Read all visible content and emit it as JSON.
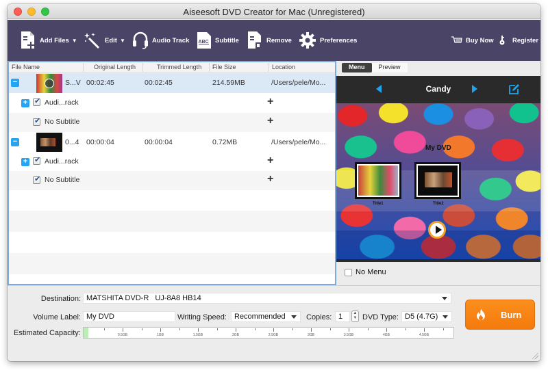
{
  "window": {
    "title": "Aiseesoft DVD Creator for Mac (Unregistered)"
  },
  "toolbar": {
    "add_files": "Add Files",
    "edit": "Edit",
    "audio_track": "Audio Track",
    "subtitle": "Subtitle",
    "remove": "Remove",
    "preferences": "Preferences",
    "buy_now": "Buy Now",
    "register": "Register"
  },
  "file_list": {
    "columns": [
      "File Name",
      "Original Length",
      "Trimmed Length",
      "File Size",
      "Location"
    ],
    "files": [
      {
        "name": "S...V",
        "original_length": "00:02:45",
        "trimmed_length": "00:02:45",
        "file_size": "214.59MB",
        "location": "/Users/pele/Mo...",
        "audio_track": "Audi...rack",
        "subtitle": "No Subtitle",
        "selected": true
      },
      {
        "name": "0...4",
        "original_length": "00:00:04",
        "trimmed_length": "00:00:04",
        "file_size": "0.72MB",
        "location": "/Users/pele/Mo...",
        "audio_track": "Audi...rack",
        "subtitle": "No Subtitle",
        "selected": false
      }
    ]
  },
  "preview": {
    "tabs": [
      {
        "label": "Menu",
        "active": true
      },
      {
        "label": "Preview",
        "active": false
      }
    ],
    "theme_name": "Candy",
    "dvd_title": "My DVD",
    "titles": [
      "Title1",
      "Title2"
    ],
    "no_menu_label": "No Menu",
    "no_menu_checked": false
  },
  "settings": {
    "destination_label": "Destination:",
    "destination_value": "MATSHITA DVD-R   UJ-8A8 HB14",
    "volume_label_label": "Volume Label:",
    "volume_label_value": "My DVD",
    "writing_speed_label": "Writing Speed:",
    "writing_speed_value": "Recommended",
    "copies_label": "Copies:",
    "copies_value": "1",
    "dvd_type_label": "DVD Type:",
    "dvd_type_value": "D5 (4.7G)",
    "capacity_label": "Estimated Capacity:",
    "capacity_used_fraction": 0.025,
    "capacity_ticks": [
      "0.5GB",
      "1GB",
      "1.5GB",
      "2GB",
      "2.5GB",
      "3GB",
      "3.5GB",
      "4GB",
      "4.5GB"
    ],
    "burn_label": "Burn"
  },
  "colors": {
    "toolbar_bg": "#4a4466",
    "accent_blue": "#26a3f1",
    "burn_orange": "#f5820f",
    "capacity_fill": "#b9efb4"
  }
}
